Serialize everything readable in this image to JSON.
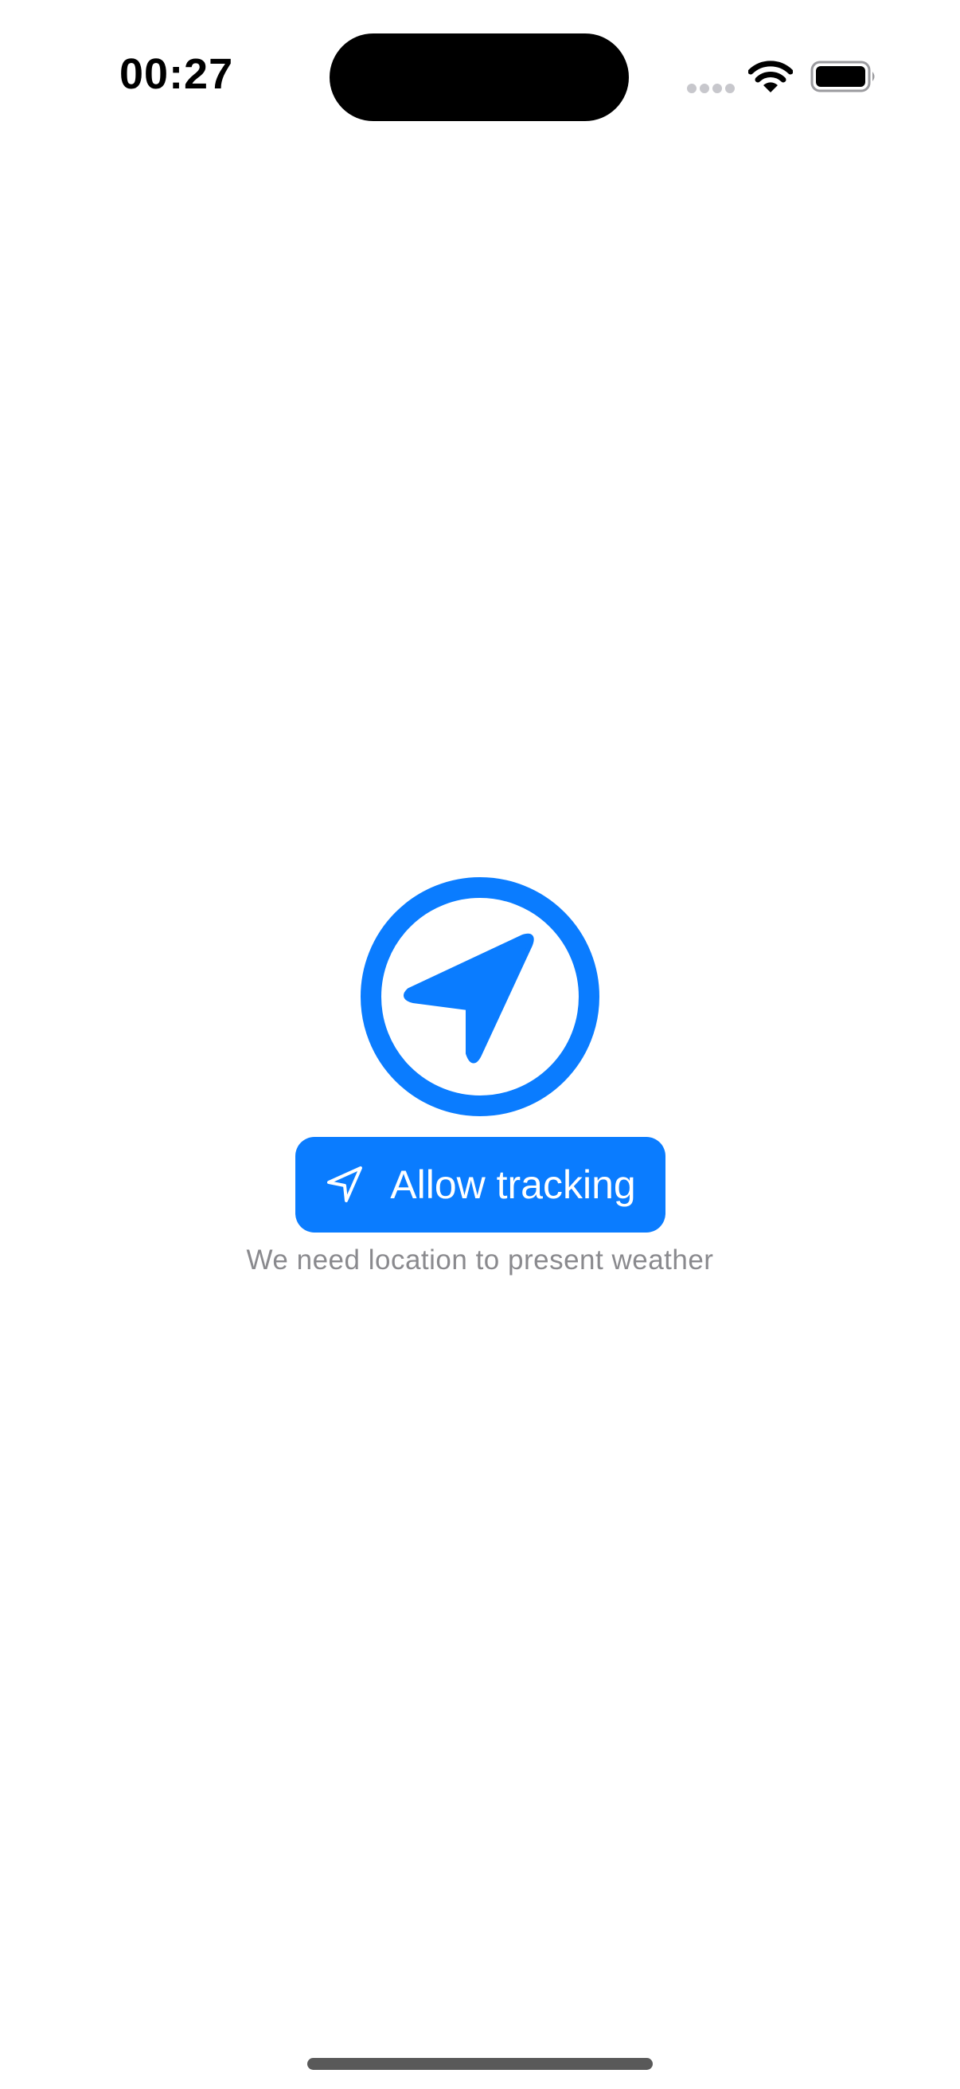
{
  "status_bar": {
    "time": "00:27",
    "icons": [
      "signal-icon",
      "wifi-icon",
      "battery-icon"
    ]
  },
  "main": {
    "hero_icon": "location-circle-icon",
    "allow_button": {
      "label": "Allow tracking",
      "icon": "location-arrow-icon"
    },
    "caption": "We need location to present weather"
  },
  "colors": {
    "accent": "#0a7cff",
    "caption_text": "#8a8a8e",
    "background": "#ffffff"
  }
}
